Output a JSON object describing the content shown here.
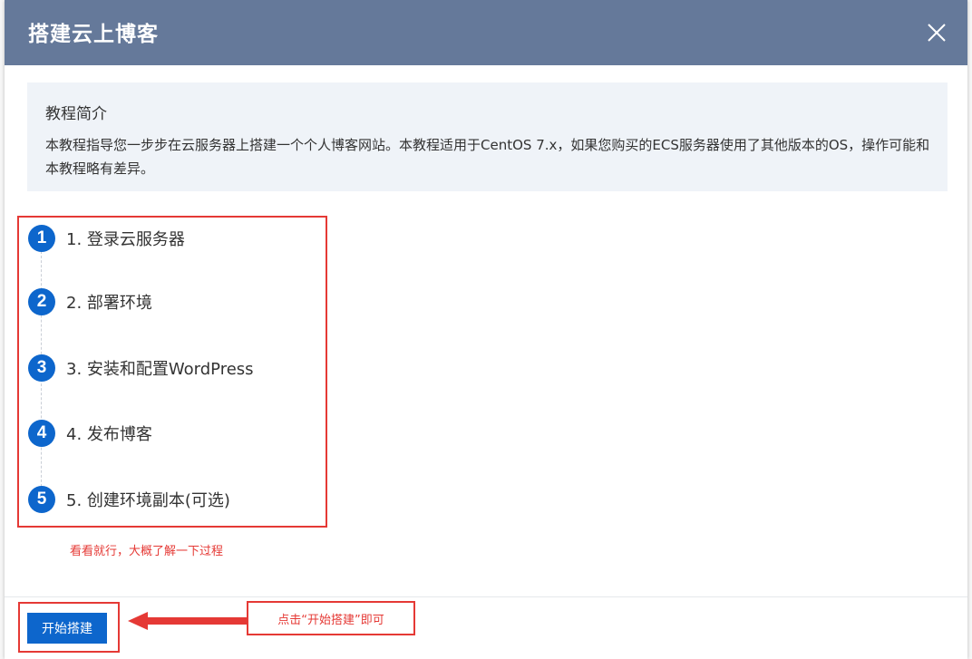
{
  "modal": {
    "title": "搭建云上博客",
    "close_icon": "close-icon"
  },
  "intro": {
    "title": "教程简介",
    "body": "本教程指导您一步步在云服务器上搭建一个个人博客网站。本教程适用于CentOS 7.x，如果您购买的ECS服务器使用了其他版本的OS，操作可能和本教程略有差异。"
  },
  "steps": [
    {
      "num": "1",
      "label": "1. 登录云服务器"
    },
    {
      "num": "2",
      "label": "2. 部署环境"
    },
    {
      "num": "3",
      "label": "3. 安装和配置WordPress"
    },
    {
      "num": "4",
      "label": "4. 发布博客"
    },
    {
      "num": "5",
      "label": "5. 创建环境副本(可选)"
    }
  ],
  "annotations": {
    "steps_note": "看看就行，大概了解一下过程",
    "start_note": "点击“开始搭建”即可"
  },
  "footer": {
    "start_button": "开始搭建"
  },
  "colors": {
    "header": "#65799a",
    "accent": "#0d66cc",
    "annotation": "#e53935"
  }
}
